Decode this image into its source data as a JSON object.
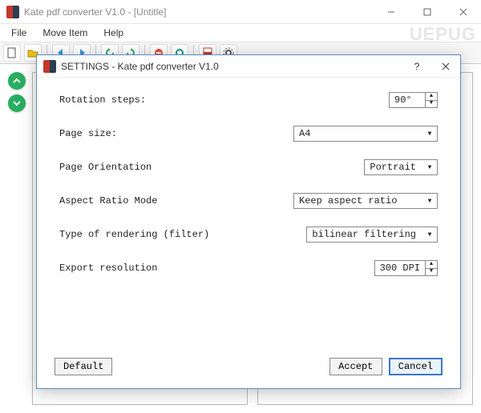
{
  "window": {
    "title": "Kate pdf converter V1.0 - [Untitle]"
  },
  "menu": {
    "file": "File",
    "move_item": "Move Item",
    "help": "Help"
  },
  "watermark": "UEPUG",
  "dialog": {
    "title": "SETTINGS - Kate pdf converter V1.0",
    "rows": {
      "rotation": {
        "label": "Rotation steps:",
        "value": "90°"
      },
      "page_size": {
        "label": "Page size:",
        "value": "A4"
      },
      "orientation": {
        "label": "Page Orientation",
        "value": "Portrait"
      },
      "aspect": {
        "label": "Aspect Ratio Mode",
        "value": "Keep aspect ratio"
      },
      "rendering": {
        "label": "Type of rendering (filter)",
        "value": "bilinear filtering"
      },
      "resolution": {
        "label": "Export resolution",
        "value": "300 DPI"
      }
    },
    "buttons": {
      "default": "Default",
      "accept": "Accept",
      "cancel": "Cancel"
    }
  }
}
